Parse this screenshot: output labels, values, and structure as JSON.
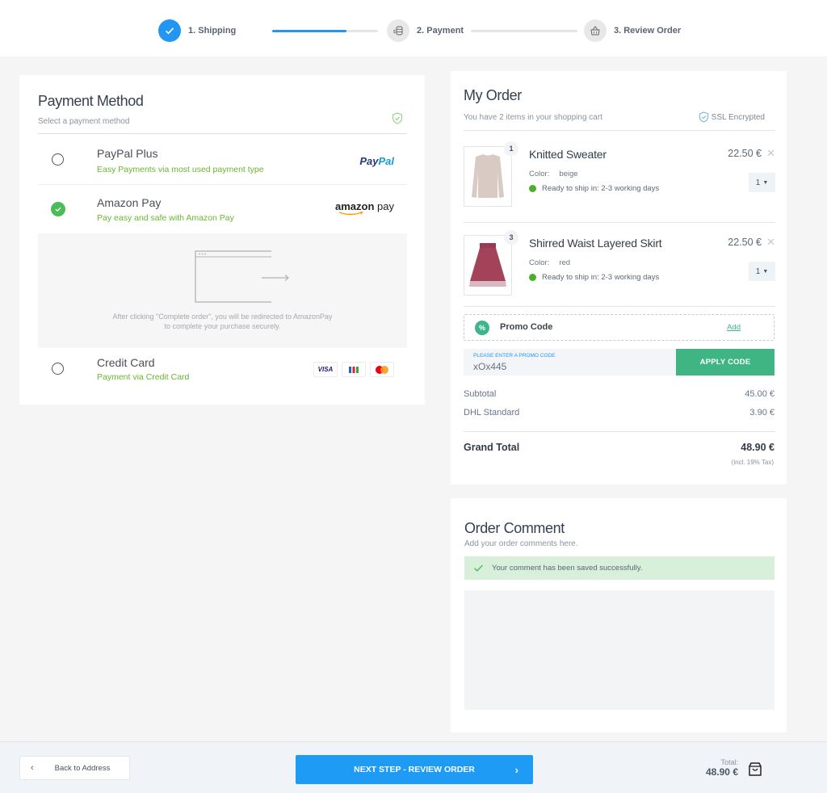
{
  "stepper": {
    "steps": [
      {
        "label": "1. Shipping",
        "icon": "check-icon",
        "state": "done"
      },
      {
        "label": "2. Payment",
        "icon": "coins-icon",
        "state": "current"
      },
      {
        "label": "3. Review Order",
        "icon": "basket-icon",
        "state": "todo"
      }
    ],
    "progress_1_to_2": 0.7,
    "progress_2_to_3": 0
  },
  "payment": {
    "title": "Payment Method",
    "subtitle": "Select a payment method",
    "options": [
      {
        "name": "PayPal Plus",
        "description": "Easy Payments via most used payment type",
        "logo": "PayPal",
        "selected": false
      },
      {
        "name": "Amazon Pay",
        "description": "Pay easy and safe with Amazon Pay",
        "logo": "amazon pay",
        "selected": true
      },
      {
        "name": "Credit Card",
        "description": "Payment via Credit Card",
        "logo": "visa jcb mastercard",
        "selected": false
      }
    ],
    "paypal_logo": {
      "part1": "Pay",
      "part2": "Pal"
    },
    "amazon_logo": {
      "part1": "amazon",
      "part2": " pay"
    },
    "amazon_note_line1": "After clicking \"Complete order\", you will be redirected to AmazonPay",
    "amazon_note_line2": "to complete your purchase securely.",
    "cc_visa": "VISA"
  },
  "order": {
    "title": "My Order",
    "subtitle": "You have 2 items in your shopping cart",
    "ssl_label": "SSL Encrypted",
    "items": [
      {
        "name": "Knitted Sweater",
        "badge": "1",
        "color_label": "Color:",
        "color": "beige",
        "shipping": "Ready to ship in: 2-3 working days",
        "price": "22.50 €",
        "qty": "1"
      },
      {
        "name": "Shirred Waist Layered Skirt",
        "badge": "3",
        "color_label": "Color:",
        "color": "red",
        "shipping": "Ready to ship in: 2-3 working days",
        "price": "22.50 €",
        "qty": "1"
      }
    ],
    "promo": {
      "label": "Promo Code",
      "icon_text": "%",
      "add_label": "Add",
      "input_label": "PLEASE ENTER A PROMO CODE",
      "input_value": "xOx445",
      "apply_label": "APPLY CODE"
    },
    "subtotal_label": "Subtotal",
    "subtotal_value": "45.00 €",
    "shipping_label": "DHL Standard",
    "shipping_value": "3.90 €",
    "grand_total_label": "Grand Total",
    "grand_total_value": "48.90 €",
    "tax_note": "(incl. 19% Tax)"
  },
  "comment": {
    "title": "Order Comment",
    "subtitle": "Add your order comments here.",
    "success_message": "Your comment has been saved successfully.",
    "text": ""
  },
  "footer": {
    "back_label": "Back to Address",
    "next_label": "NEXT STEP - REVIEW ORDER",
    "total_label": "Total:",
    "total_value": "48.90 €"
  },
  "colors": {
    "primary": "#1e9cf5",
    "success_green": "#4cbb5a",
    "promo_green": "#3fb583",
    "desc_green": "#6ab52f"
  }
}
